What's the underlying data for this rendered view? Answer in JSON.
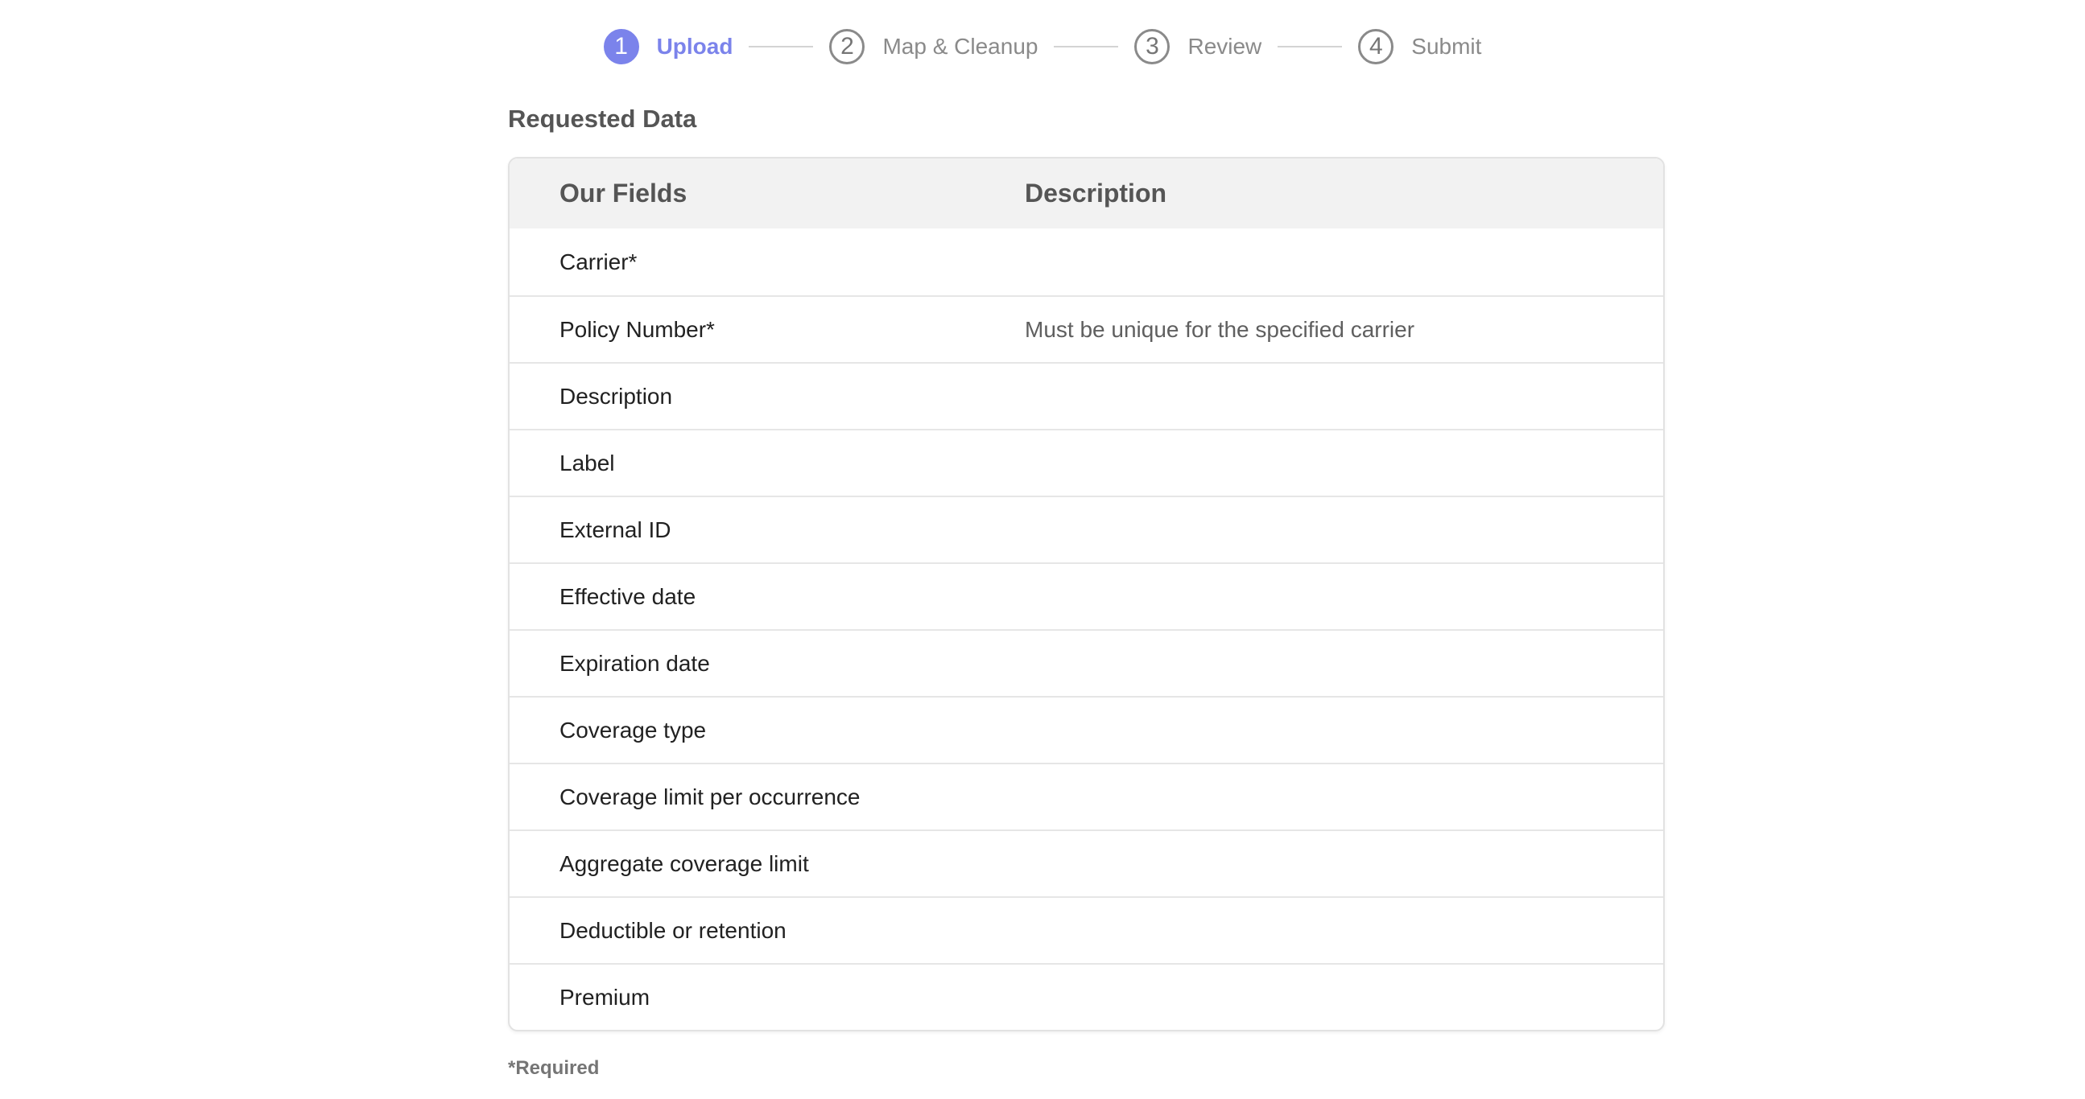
{
  "stepper": {
    "steps": [
      {
        "number": "1",
        "label": "Upload",
        "active": true
      },
      {
        "number": "2",
        "label": "Map & Cleanup",
        "active": false
      },
      {
        "number": "3",
        "label": "Review",
        "active": false
      },
      {
        "number": "4",
        "label": "Submit",
        "active": false
      }
    ],
    "active_color": "#7b83eb",
    "inactive_color": "#8a8a8a"
  },
  "section_title": "Requested Data",
  "table": {
    "headers": {
      "field": "Our Fields",
      "description": "Description"
    },
    "rows": [
      {
        "field": "Carrier*",
        "description": ""
      },
      {
        "field": "Policy Number*",
        "description": "Must be unique for the specified carrier"
      },
      {
        "field": "Description",
        "description": ""
      },
      {
        "field": "Label",
        "description": ""
      },
      {
        "field": "External ID",
        "description": ""
      },
      {
        "field": "Effective date",
        "description": ""
      },
      {
        "field": "Expiration date",
        "description": ""
      },
      {
        "field": "Coverage type",
        "description": ""
      },
      {
        "field": "Coverage limit per occurrence",
        "description": ""
      },
      {
        "field": "Aggregate coverage limit",
        "description": ""
      },
      {
        "field": "Deductible or retention",
        "description": ""
      },
      {
        "field": "Premium",
        "description": ""
      }
    ]
  },
  "footnote": "*Required"
}
